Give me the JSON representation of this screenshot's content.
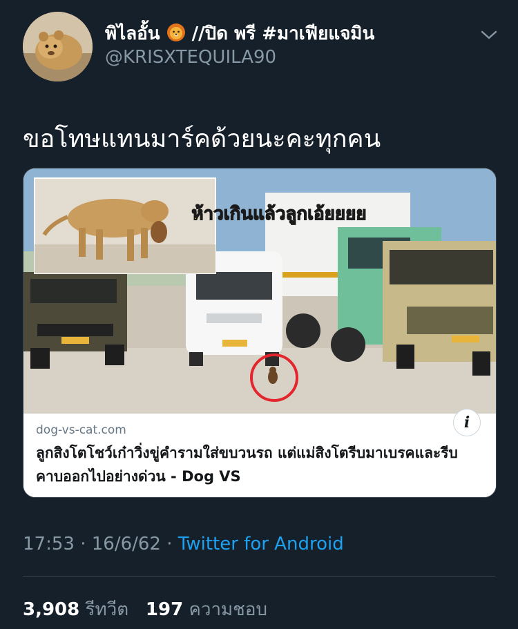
{
  "tweet": {
    "author_name": "พิไลอั้น",
    "author_name_suffix": " //ปิด พรี #มาเฟียแจมิน",
    "author_emoji_icon": "lion-face-icon",
    "handle": "@KRISXTEQUILA90",
    "text": "ขอโทษแทนมาร์คด้วยนะคะทุกคน",
    "time": "17:53",
    "separator": "·",
    "date": "16/6/62",
    "client": "Twitter for Android",
    "retweets": "3,908",
    "retweets_label": "รีทวีต",
    "likes": "197",
    "likes_label": "ความชอบ"
  },
  "card": {
    "image_caption": "ห้าวเกินแล้วลูกเอ้ยยยย",
    "domain": "dog-vs-cat.com",
    "title": "ลูกสิงโตโชว์เก๋าวิ่งขู่คำรามใส่ขบวนรถ แต่แม่สิงโตรีบมาเบรคและรีบคาบออกไปอย่างด่วน - Dog VS",
    "info_glyph": "i"
  },
  "colors": {
    "background": "#15202b",
    "secondary_text": "#8899a6",
    "link": "#1da1f2",
    "border": "#38444d",
    "circle_marker": "#e3262e"
  }
}
